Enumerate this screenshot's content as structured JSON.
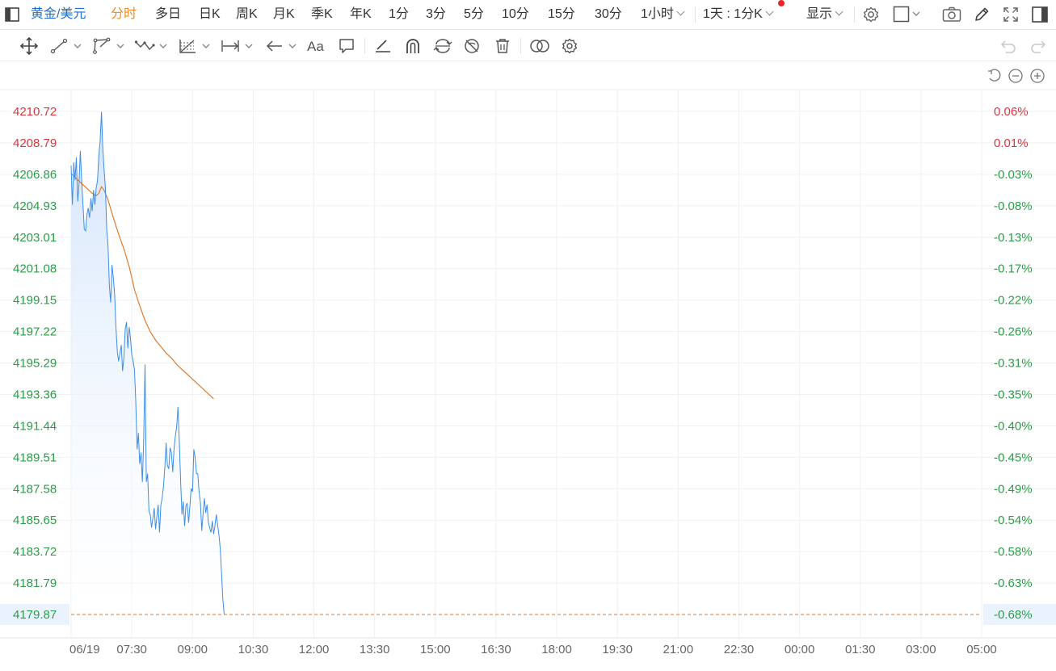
{
  "toolbar": {
    "symbol": "黄金/美元",
    "periods": [
      "分时",
      "多日",
      "日K",
      "周K",
      "月K",
      "季K",
      "年K",
      "1分",
      "3分",
      "5分",
      "10分",
      "15分",
      "30分"
    ],
    "active_period": "分时",
    "interval_dropdown": "1小时",
    "range_dropdown": "1天 : 1分K",
    "display_dropdown": "显示",
    "notification_color": "#e8252a"
  },
  "drawing_tools": {
    "text_tool_label": "Aa",
    "icons": [
      "move-icon",
      "line-tool-icon",
      "polyline-tool-icon",
      "wave-tool-icon",
      "fibonacci-tool-icon",
      "measure-tool-icon",
      "arrow-tool-icon",
      "text-tool-icon",
      "comment-tool-icon",
      "pencil-tool-icon",
      "magnet-icon",
      "sync-icon",
      "hide-icon",
      "trash-icon",
      "compare-icon",
      "settings-icon"
    ],
    "undo_icon": "undo-icon",
    "redo_icon": "redo-icon"
  },
  "zoom_controls": [
    "reset-icon",
    "zoom-out-icon",
    "zoom-in-icon"
  ],
  "chart_data": {
    "type": "line",
    "colors": {
      "price": "#3d8ee6",
      "average": "#e07a2c",
      "up": "#d9363e",
      "down": "#2a9d48",
      "area_top": "#cfe2fb"
    },
    "y_labels": [
      "4210.72",
      "4208.79",
      "4206.86",
      "4204.93",
      "4203.01",
      "4201.08",
      "4199.15",
      "4197.22",
      "4195.29",
      "4193.36",
      "4191.44",
      "4189.51",
      "4187.58",
      "4185.65",
      "4183.72",
      "4181.79",
      "4179.87"
    ],
    "pct_labels": [
      "0.06%",
      "0.01%",
      "-0.03%",
      "-0.08%",
      "-0.13%",
      "-0.17%",
      "-0.22%",
      "-0.26%",
      "-0.31%",
      "-0.35%",
      "-0.40%",
      "-0.45%",
      "-0.49%",
      "-0.54%",
      "-0.58%",
      "-0.63%",
      "-0.68%"
    ],
    "y_up_count": 2,
    "ylim": [
      4179.87,
      4210.72
    ],
    "x_labels": [
      "06/19",
      "07:30",
      "09:00",
      "10:30",
      "12:00",
      "13:30",
      "15:00",
      "16:30",
      "18:00",
      "19:30",
      "21:00",
      "22:30",
      "00:00",
      "01:30",
      "03:00",
      "05:00"
    ],
    "x_axis_minutes": {
      "start": "06:00",
      "end": "05:00",
      "total": 1380
    },
    "current_price_label": "4179.87",
    "current_pct_label": "-0.68%",
    "price_series": [
      [
        0,
        4207.4
      ],
      [
        2,
        4205.0
      ],
      [
        4,
        4207.6
      ],
      [
        6,
        4206.5
      ],
      [
        8,
        4207.9
      ],
      [
        10,
        4205.2
      ],
      [
        12,
        4206.3
      ],
      [
        14,
        4208.3
      ],
      [
        16,
        4206.5
      ],
      [
        18,
        4205.0
      ],
      [
        20,
        4203.5
      ],
      [
        22,
        4203.4
      ],
      [
        24,
        4204.4
      ],
      [
        26,
        4204.8
      ],
      [
        28,
        4204.2
      ],
      [
        30,
        4205.4
      ],
      [
        32,
        4204.6
      ],
      [
        34,
        4205.9
      ],
      [
        36,
        4205.0
      ],
      [
        38,
        4206.0
      ],
      [
        40,
        4206.5
      ],
      [
        42,
        4208.0
      ],
      [
        44,
        4208.9
      ],
      [
        46,
        4210.7
      ],
      [
        48,
        4208.5
      ],
      [
        50,
        4207.2
      ],
      [
        52,
        4206.0
      ],
      [
        54,
        4203.5
      ],
      [
        56,
        4202.5
      ],
      [
        58,
        4200.0
      ],
      [
        60,
        4199.0
      ],
      [
        62,
        4201.3
      ],
      [
        64,
        4200.5
      ],
      [
        66,
        4199.5
      ],
      [
        68,
        4197.5
      ],
      [
        70,
        4196.0
      ],
      [
        72,
        4195.4
      ],
      [
        74,
        4195.9
      ],
      [
        76,
        4196.4
      ],
      [
        78,
        4194.8
      ],
      [
        80,
        4195.6
      ],
      [
        82,
        4197.4
      ],
      [
        84,
        4197.8
      ],
      [
        86,
        4196.2
      ],
      [
        88,
        4197.5
      ],
      [
        90,
        4196.8
      ],
      [
        92,
        4195.8
      ],
      [
        94,
        4195.4
      ],
      [
        96,
        4194.9
      ],
      [
        98,
        4193.0
      ],
      [
        100,
        4190.0
      ],
      [
        102,
        4191.0
      ],
      [
        104,
        4189.1
      ],
      [
        106,
        4189.8
      ],
      [
        108,
        4188.0
      ],
      [
        110,
        4190.5
      ],
      [
        112,
        4195.2
      ],
      [
        114,
        4188.0
      ],
      [
        116,
        4188.5
      ],
      [
        118,
        4186.2
      ],
      [
        120,
        4186.0
      ],
      [
        122,
        4185.2
      ],
      [
        124,
        4185.8
      ],
      [
        126,
        4186.4
      ],
      [
        128,
        4185.1
      ],
      [
        130,
        4185.9
      ],
      [
        132,
        4186.6
      ],
      [
        134,
        4184.9
      ],
      [
        136,
        4186.6
      ],
      [
        138,
        4187.0
      ],
      [
        140,
        4187.7
      ],
      [
        142,
        4188.9
      ],
      [
        144,
        4190.4
      ],
      [
        146,
        4189.0
      ],
      [
        148,
        4188.8
      ],
      [
        150,
        4190.1
      ],
      [
        152,
        4189.8
      ],
      [
        154,
        4188.6
      ],
      [
        156,
        4190.0
      ],
      [
        158,
        4190.8
      ],
      [
        160,
        4191.4
      ],
      [
        162,
        4192.6
      ],
      [
        164,
        4190.5
      ],
      [
        166,
        4188.0
      ],
      [
        168,
        4186.0
      ],
      [
        170,
        4186.8
      ],
      [
        172,
        4185.3
      ],
      [
        174,
        4186.5
      ],
      [
        176,
        4186.7
      ],
      [
        178,
        4185.5
      ],
      [
        180,
        4186.5
      ],
      [
        182,
        4187.6
      ],
      [
        184,
        4187.4
      ],
      [
        186,
        4190.0
      ],
      [
        188,
        4189.5
      ],
      [
        190,
        4188.5
      ],
      [
        192,
        4188.5
      ],
      [
        194,
        4187.4
      ],
      [
        196,
        4186.7
      ],
      [
        198,
        4185.0
      ],
      [
        200,
        4186.0
      ],
      [
        202,
        4187.0
      ],
      [
        204,
        4186.1
      ],
      [
        206,
        4186.6
      ],
      [
        208,
        4185.5
      ],
      [
        210,
        4185.2
      ],
      [
        212,
        4184.9
      ],
      [
        214,
        4185.6
      ],
      [
        216,
        4184.8
      ],
      [
        218,
        4185.3
      ],
      [
        220,
        4186.0
      ],
      [
        222,
        4185.4
      ],
      [
        224,
        4184.8
      ],
      [
        226,
        4183.9
      ],
      [
        228,
        4182.4
      ],
      [
        230,
        4180.8
      ],
      [
        232,
        4179.87
      ]
    ],
    "average_series": [
      [
        0,
        4206.9
      ],
      [
        8,
        4206.6
      ],
      [
        16,
        4206.3
      ],
      [
        24,
        4206.0
      ],
      [
        32,
        4205.7
      ],
      [
        38,
        4205.55
      ],
      [
        42,
        4205.7
      ],
      [
        46,
        4206.1
      ],
      [
        50,
        4205.9
      ],
      [
        56,
        4205.3
      ],
      [
        64,
        4204.2
      ],
      [
        72,
        4203.2
      ],
      [
        80,
        4202.3
      ],
      [
        88,
        4201.2
      ],
      [
        96,
        4199.8
      ],
      [
        104,
        4198.8
      ],
      [
        112,
        4197.9
      ],
      [
        120,
        4197.2
      ],
      [
        128,
        4196.7
      ],
      [
        136,
        4196.3
      ],
      [
        144,
        4195.9
      ],
      [
        152,
        4195.6
      ],
      [
        160,
        4195.2
      ],
      [
        168,
        4194.9
      ],
      [
        176,
        4194.6
      ],
      [
        184,
        4194.3
      ],
      [
        192,
        4194.0
      ],
      [
        200,
        4193.7
      ],
      [
        208,
        4193.4
      ],
      [
        216,
        4193.1
      ]
    ]
  }
}
